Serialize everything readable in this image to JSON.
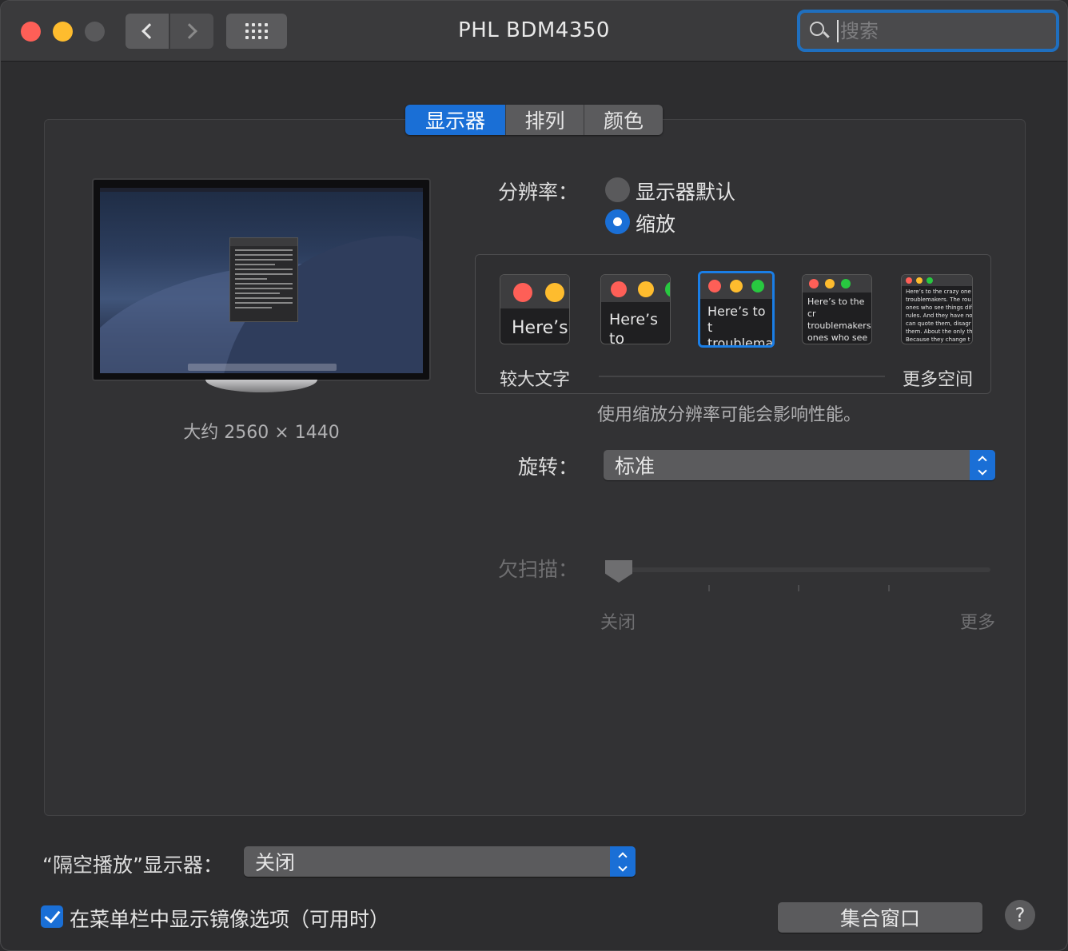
{
  "window": {
    "title": "PHL BDM4350",
    "search_placeholder": "搜索"
  },
  "tabs": [
    {
      "label": "显示器",
      "active": true
    },
    {
      "label": "排列",
      "active": false
    },
    {
      "label": "颜色",
      "active": false
    }
  ],
  "display": {
    "resolution_caption": "大约 2560 × 1440"
  },
  "resolution": {
    "label": "分辨率：",
    "options": [
      {
        "label": "显示器默认",
        "selected": false
      },
      {
        "label": "缩放",
        "selected": true
      }
    ],
    "scale_left_label": "较大文字",
    "scale_right_label": "更多空间",
    "performance_note": "使用缩放分辨率可能会影响性能。",
    "thumbnails": [
      {
        "text": "Here’s",
        "selected": false
      },
      {
        "text": "Here’s to troublem",
        "selected": false
      },
      {
        "text": "Here’s to t troublema ones who",
        "selected": true
      },
      {
        "text": "Here’s to the cr troublemakers. ones who see t rules. And they",
        "selected": false
      },
      {
        "text": "Here’s to the crazy one troublemakers. The rou ones who see things dif rules. And they have no can quote them, disagr them. About the only th Because they change t",
        "selected": false
      }
    ]
  },
  "rotation": {
    "label": "旋转：",
    "value": "标准"
  },
  "underscan": {
    "label": "欠扫描：",
    "min_label": "关闭",
    "max_label": "更多",
    "value": 0
  },
  "airplay": {
    "label": "“隔空播放”显示器：",
    "value": "关闭"
  },
  "mirror_option": {
    "label": "在菜单栏中显示镜像选项（可用时）",
    "checked": true
  },
  "gather_button": "集合窗口",
  "help_button": "?",
  "colors": {
    "accent": "#1a6fd6",
    "traffic_close": "#fe5f57",
    "traffic_minimize": "#febc2e"
  }
}
